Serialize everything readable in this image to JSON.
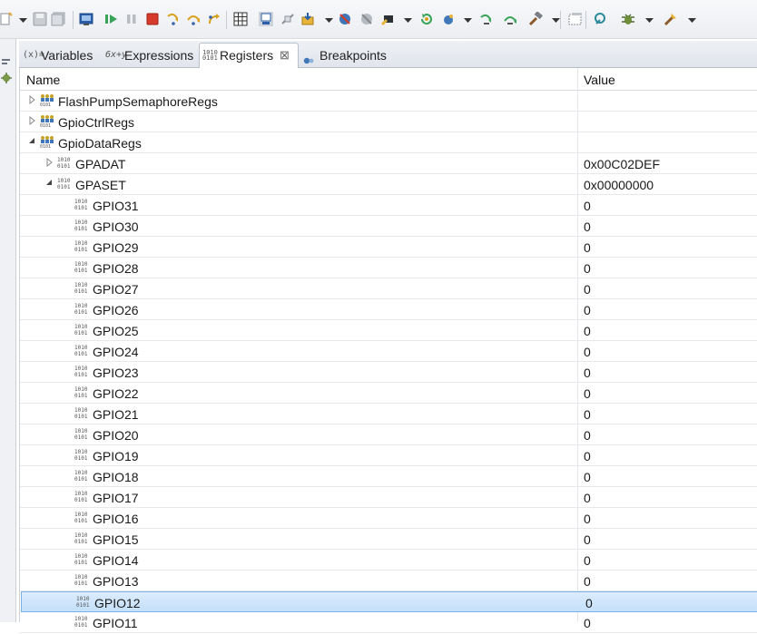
{
  "toolbar": {
    "icons": [
      "new-icon",
      "dropdown-arrow-icon",
      "save-icon",
      "save-all-icon",
      "terminate-debug-icon",
      "resume-icon",
      "suspend-icon",
      "terminate-icon",
      "step-into-icon",
      "step-over-icon",
      "step-return-icon",
      "memory-table-icon",
      "debug-view-icon",
      "connect-icon",
      "load-program-icon",
      "dropdown-arrow-icon",
      "breakpoint-icon",
      "remove-breakpoint-icon",
      "hardware-icon",
      "dropdown-arrow-icon",
      "restart-icon",
      "run-icon",
      "dropdown-arrow-icon",
      "assembly-step-into-icon",
      "assembly-step-over-icon",
      "build-icon",
      "dropdown-arrow-icon",
      "new-window-icon",
      "search-icon",
      "debug-bug-icon",
      "dropdown-arrow-icon",
      "external-tools-icon",
      "dropdown-arrow-icon"
    ]
  },
  "tabs": [
    {
      "icon": "(x)=",
      "label": "Variables",
      "active": false
    },
    {
      "icon": "6x+y",
      "label": "Expressions",
      "active": false
    },
    {
      "icon": "1010",
      "label": "Registers",
      "active": true
    },
    {
      "icon": "●",
      "label": "Breakpoints",
      "active": false
    }
  ],
  "tab_close": "⊠",
  "table": {
    "columns": [
      "Name",
      "Value"
    ],
    "rows": [
      {
        "name": "FlashPumpSemaphoreRegs",
        "value": "",
        "level": 0,
        "expander": "collapsed",
        "kind": "group",
        "selected": false
      },
      {
        "name": "GpioCtrlRegs",
        "value": "",
        "level": 0,
        "expander": "collapsed",
        "kind": "group",
        "selected": false
      },
      {
        "name": "GpioDataRegs",
        "value": "",
        "level": 0,
        "expander": "expanded",
        "kind": "group",
        "selected": false
      },
      {
        "name": "GPADAT",
        "value": "0x00C02DEF",
        "level": 1,
        "expander": "collapsed",
        "kind": "register",
        "selected": false
      },
      {
        "name": "GPASET",
        "value": "0x00000000",
        "level": 1,
        "expander": "expanded",
        "kind": "register",
        "selected": false
      },
      {
        "name": "GPIO31",
        "value": "0",
        "level": 2,
        "expander": "none",
        "kind": "field",
        "selected": false
      },
      {
        "name": "GPIO30",
        "value": "0",
        "level": 2,
        "expander": "none",
        "kind": "field",
        "selected": false
      },
      {
        "name": "GPIO29",
        "value": "0",
        "level": 2,
        "expander": "none",
        "kind": "field",
        "selected": false
      },
      {
        "name": "GPIO28",
        "value": "0",
        "level": 2,
        "expander": "none",
        "kind": "field",
        "selected": false
      },
      {
        "name": "GPIO27",
        "value": "0",
        "level": 2,
        "expander": "none",
        "kind": "field",
        "selected": false
      },
      {
        "name": "GPIO26",
        "value": "0",
        "level": 2,
        "expander": "none",
        "kind": "field",
        "selected": false
      },
      {
        "name": "GPIO25",
        "value": "0",
        "level": 2,
        "expander": "none",
        "kind": "field",
        "selected": false
      },
      {
        "name": "GPIO24",
        "value": "0",
        "level": 2,
        "expander": "none",
        "kind": "field",
        "selected": false
      },
      {
        "name": "GPIO23",
        "value": "0",
        "level": 2,
        "expander": "none",
        "kind": "field",
        "selected": false
      },
      {
        "name": "GPIO22",
        "value": "0",
        "level": 2,
        "expander": "none",
        "kind": "field",
        "selected": false
      },
      {
        "name": "GPIO21",
        "value": "0",
        "level": 2,
        "expander": "none",
        "kind": "field",
        "selected": false
      },
      {
        "name": "GPIO20",
        "value": "0",
        "level": 2,
        "expander": "none",
        "kind": "field",
        "selected": false
      },
      {
        "name": "GPIO19",
        "value": "0",
        "level": 2,
        "expander": "none",
        "kind": "field",
        "selected": false
      },
      {
        "name": "GPIO18",
        "value": "0",
        "level": 2,
        "expander": "none",
        "kind": "field",
        "selected": false
      },
      {
        "name": "GPIO17",
        "value": "0",
        "level": 2,
        "expander": "none",
        "kind": "field",
        "selected": false
      },
      {
        "name": "GPIO16",
        "value": "0",
        "level": 2,
        "expander": "none",
        "kind": "field",
        "selected": false
      },
      {
        "name": "GPIO15",
        "value": "0",
        "level": 2,
        "expander": "none",
        "kind": "field",
        "selected": false
      },
      {
        "name": "GPIO14",
        "value": "0",
        "level": 2,
        "expander": "none",
        "kind": "field",
        "selected": false
      },
      {
        "name": "GPIO13",
        "value": "0",
        "level": 2,
        "expander": "none",
        "kind": "field",
        "selected": false
      },
      {
        "name": "GPIO12",
        "value": "0",
        "level": 2,
        "expander": "none",
        "kind": "field",
        "selected": true
      },
      {
        "name": "GPIO11",
        "value": "0",
        "level": 2,
        "expander": "none",
        "kind": "field",
        "selected": false
      }
    ]
  },
  "colors": {
    "selection_border": "#7db2e8",
    "selection_fill": "#cfe6fb",
    "group_icon": "#c8a228"
  }
}
